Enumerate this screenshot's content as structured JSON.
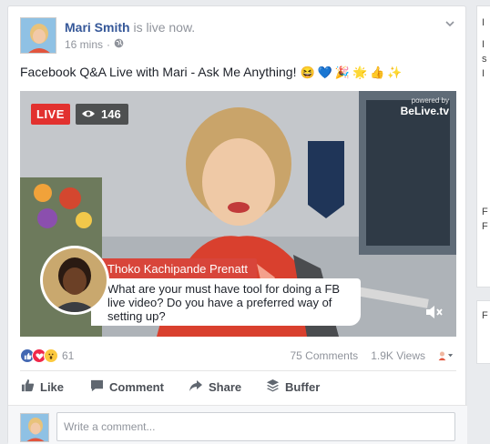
{
  "post": {
    "author": "Mari Smith",
    "status": "is live now.",
    "time": "16 mins",
    "visibility_icon": "globe-icon",
    "text": "Facebook Q&A Live with Mari - Ask Me Anything!",
    "emojis": [
      "😆",
      "💙",
      "🎉",
      "🌟",
      "👍",
      "✨"
    ]
  },
  "video": {
    "live_label": "LIVE",
    "viewer_count": "146",
    "powered_by": "powered by",
    "brand": "BeLive.tv",
    "comment": {
      "name": "Thoko Kachipande Prenatt",
      "text": "What are your must have tool for doing a FB live video? Do you have a preferred way of setting up?"
    }
  },
  "reactions": {
    "count": "61",
    "types": [
      "like-icon",
      "love-icon",
      "wow-icon"
    ],
    "comments": "75 Comments",
    "views": "1.9K Views"
  },
  "actions": {
    "like": "Like",
    "comment": "Comment",
    "share": "Share",
    "buffer": "Buffer"
  },
  "comment_input": {
    "placeholder": "Write a comment..."
  },
  "right_column_chars": [
    "I",
    "I",
    "s",
    "I",
    "F",
    "F",
    "F"
  ],
  "colors": {
    "link": "#365899",
    "live_red": "#e2312f",
    "comment_red": "#d8453a",
    "like_blue": "#4267b2",
    "love_red": "#f0284a",
    "wow_yellow": "#fcc93e"
  }
}
